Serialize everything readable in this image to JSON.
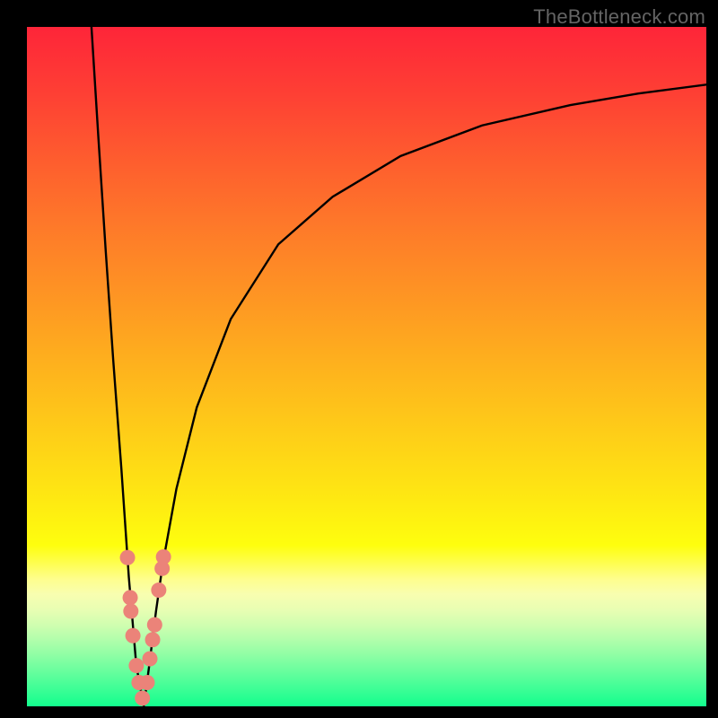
{
  "watermark": {
    "text": "TheBottleneck.com"
  },
  "colors": {
    "frame": "#000000",
    "curve": "#000000",
    "marker_fill": "#eb8379",
    "gradient_stops": [
      {
        "offset": 0.0,
        "color": "#fe2539"
      },
      {
        "offset": 0.1,
        "color": "#fe4034"
      },
      {
        "offset": 0.2,
        "color": "#fe5e2e"
      },
      {
        "offset": 0.3,
        "color": "#fe7b29"
      },
      {
        "offset": 0.4,
        "color": "#fe9623"
      },
      {
        "offset": 0.5,
        "color": "#feb21d"
      },
      {
        "offset": 0.6,
        "color": "#fece18"
      },
      {
        "offset": 0.7,
        "color": "#feea12"
      },
      {
        "offset": 0.763,
        "color": "#fefe0e"
      },
      {
        "offset": 0.787,
        "color": "#fefe4a"
      },
      {
        "offset": 0.813,
        "color": "#fefe8e"
      },
      {
        "offset": 0.835,
        "color": "#f8feb0"
      },
      {
        "offset": 0.858,
        "color": "#e8feb3"
      },
      {
        "offset": 0.88,
        "color": "#d0feb0"
      },
      {
        "offset": 0.9,
        "color": "#b4feac"
      },
      {
        "offset": 0.92,
        "color": "#96fea6"
      },
      {
        "offset": 0.94,
        "color": "#76fea0"
      },
      {
        "offset": 0.96,
        "color": "#55fe9a"
      },
      {
        "offset": 0.98,
        "color": "#34fe94"
      },
      {
        "offset": 1.0,
        "color": "#12fe8d"
      }
    ]
  },
  "chart_data": {
    "type": "line",
    "title": "",
    "xlabel": "",
    "ylabel": "",
    "xlim": [
      0,
      100
    ],
    "ylim": [
      0,
      100
    ],
    "series": [
      {
        "name": "bottleneck-curve-left",
        "x": [
          9.5,
          10.5,
          11.6,
          12.7,
          13.9,
          15.0,
          16.1,
          17.2
        ],
        "y": [
          100,
          84,
          67,
          51,
          35,
          19,
          6,
          0
        ]
      },
      {
        "name": "bottleneck-curve-right",
        "x": [
          17.2,
          18.0,
          19.0,
          20.0,
          22.0,
          25.0,
          30.0,
          37.0,
          45.0,
          55.0,
          67.0,
          80.0,
          90.0,
          100.0
        ],
        "y": [
          0,
          6,
          14,
          21,
          32,
          44,
          57,
          68,
          75,
          81,
          85.5,
          88.5,
          90.2,
          91.5
        ]
      }
    ],
    "markers": {
      "name": "highlighted-points",
      "points": [
        {
          "x": 14.8,
          "y": 21.9
        },
        {
          "x": 15.2,
          "y": 16.0
        },
        {
          "x": 15.3,
          "y": 14.0
        },
        {
          "x": 15.6,
          "y": 10.4
        },
        {
          "x": 16.1,
          "y": 6.0
        },
        {
          "x": 16.5,
          "y": 3.5
        },
        {
          "x": 17.0,
          "y": 1.2
        },
        {
          "x": 19.9,
          "y": 20.3
        },
        {
          "x": 20.1,
          "y": 22.0
        },
        {
          "x": 19.4,
          "y": 17.1
        },
        {
          "x": 18.8,
          "y": 12.0
        },
        {
          "x": 18.5,
          "y": 9.8
        },
        {
          "x": 18.1,
          "y": 7.0
        },
        {
          "x": 17.7,
          "y": 3.5
        }
      ]
    }
  }
}
